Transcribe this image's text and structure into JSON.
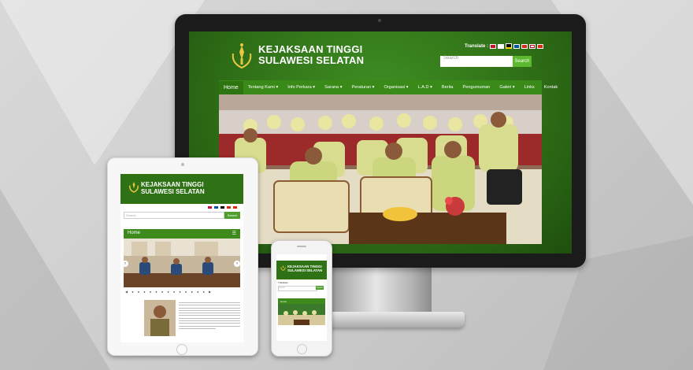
{
  "site": {
    "title_line1": "KEJAKSAAN TINGGI",
    "title_line2": "SULAWESI SELATAN",
    "translate_label": "Translate :",
    "search_placeholder": "Search",
    "search_button": "Search"
  },
  "nav": {
    "items": [
      {
        "label": "Home",
        "dropdown": false
      },
      {
        "label": "Tentang Kami ▾",
        "dropdown": true
      },
      {
        "label": "Info Perkara ▾",
        "dropdown": true
      },
      {
        "label": "Sarana ▾",
        "dropdown": true
      },
      {
        "label": "Peraturan ▾",
        "dropdown": true
      },
      {
        "label": "Organisasi ▾",
        "dropdown": true
      },
      {
        "label": "L.A.D ▾",
        "dropdown": true
      },
      {
        "label": "Berita",
        "dropdown": false
      },
      {
        "label": "Pengumuman",
        "dropdown": false
      },
      {
        "label": "Galeri ▾",
        "dropdown": true
      },
      {
        "label": "Links",
        "dropdown": false
      },
      {
        "label": "Kontak",
        "dropdown": false
      }
    ]
  },
  "tablet": {
    "nav_label": "Home",
    "search_placeholder": "Search",
    "search_button": "Search"
  },
  "phone": {
    "nav_label": "Home",
    "translate_label": "Translate :",
    "search_placeholder": "Search",
    "search_button": "Search"
  },
  "colors": {
    "brand_green": "#3a8a19",
    "dark_green": "#2f7115",
    "accent_green": "#5cb82e"
  },
  "icons": [
    "emblem-logo-icon",
    "flag-icon",
    "chevron-left-icon",
    "chevron-right-icon",
    "hamburger-menu-icon"
  ]
}
